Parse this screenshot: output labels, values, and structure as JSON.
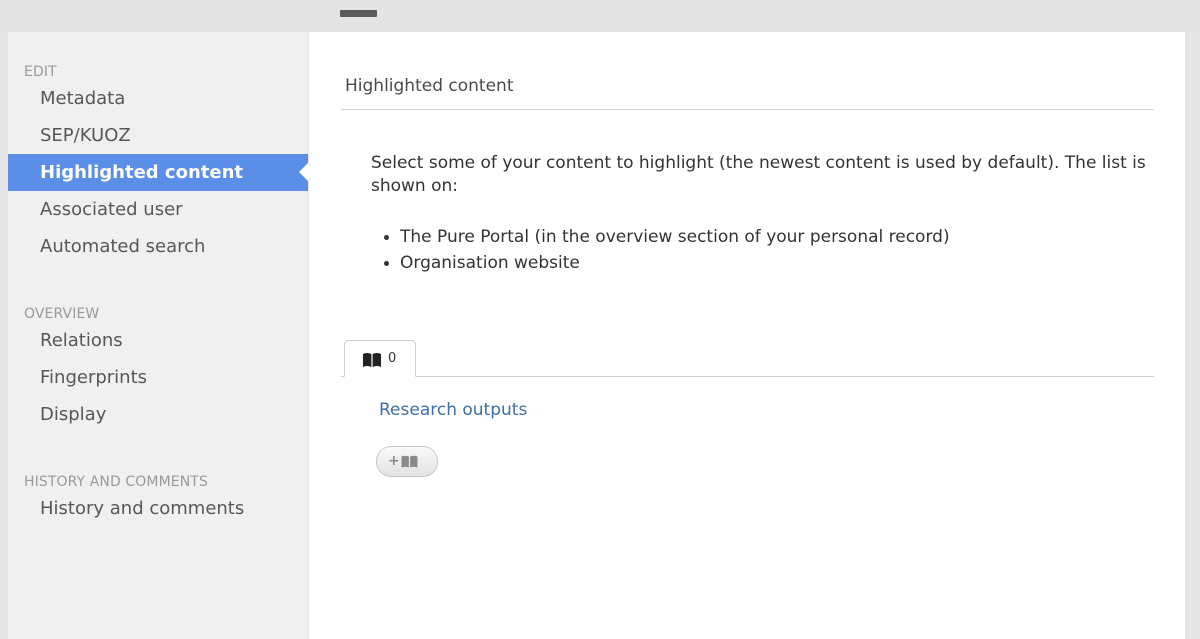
{
  "sidebar": {
    "sections": [
      {
        "heading": "EDIT",
        "items": [
          {
            "label": "Metadata",
            "active": false
          },
          {
            "label": "SEP/KUOZ",
            "active": false
          },
          {
            "label": "Highlighted content",
            "active": true
          },
          {
            "label": "Associated user",
            "active": false
          },
          {
            "label": "Automated search",
            "active": false
          }
        ]
      },
      {
        "heading": "OVERVIEW",
        "items": [
          {
            "label": "Relations",
            "active": false
          },
          {
            "label": "Fingerprints",
            "active": false
          },
          {
            "label": "Display",
            "active": false
          }
        ]
      },
      {
        "heading": "HISTORY AND COMMENTS",
        "items": [
          {
            "label": "History and comments",
            "active": false
          }
        ]
      }
    ]
  },
  "main": {
    "title": "Highlighted content",
    "description": "Select some of your content to highlight (the newest content is used by default). The list is shown on:",
    "bullets": [
      "The Pure Portal (in the overview section of your personal record)",
      "Organisation website"
    ],
    "tab": {
      "icon": "book-icon",
      "count": "0"
    },
    "outputs_link": "Research outputs",
    "add_button": {
      "plus": "+",
      "icon": "book-icon"
    }
  },
  "colors": {
    "active_nav": "#5b8ee6",
    "link": "#3c6ea8",
    "sidebar_bg": "#f0f0f0",
    "heading": "#9a9a9a"
  }
}
